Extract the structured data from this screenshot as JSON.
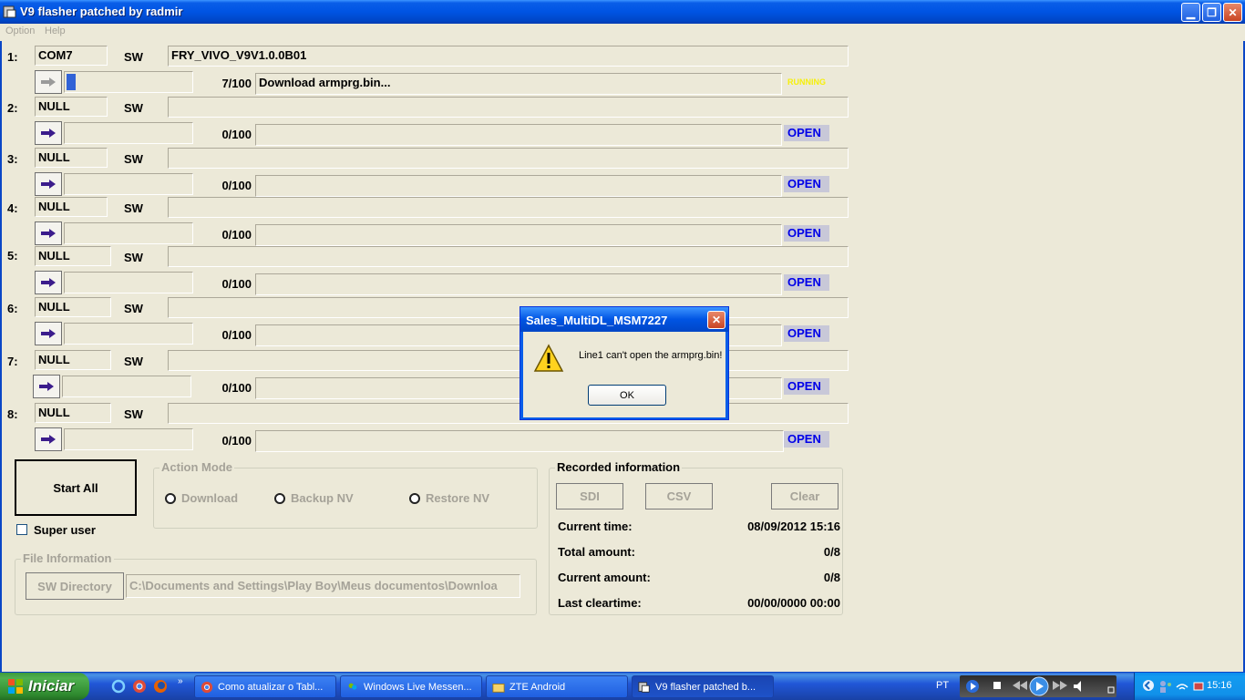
{
  "window": {
    "title": "V9 flasher patched by radmir"
  },
  "menu": {
    "option": "Option",
    "help": "Help"
  },
  "sw_label": "SW",
  "rows": [
    {
      "num": "1:",
      "port": "COM7",
      "sw": "FRY_VIVO_V9V1.0.0B01",
      "count": "7/100",
      "message": "Download armprg.bin...",
      "status": "RUNNING",
      "progress": 0.07
    },
    {
      "num": "2:",
      "port": "NULL",
      "sw": "",
      "count": "0/100",
      "message": "",
      "status": "OPEN",
      "progress": 0
    },
    {
      "num": "3:",
      "port": "NULL",
      "sw": "",
      "count": "0/100",
      "message": "",
      "status": "OPEN",
      "progress": 0
    },
    {
      "num": "4:",
      "port": "NULL",
      "sw": "",
      "count": "0/100",
      "message": "",
      "status": "OPEN",
      "progress": 0
    },
    {
      "num": "5:",
      "port": "NULL",
      "sw": "",
      "count": "0/100",
      "message": "",
      "status": "OPEN",
      "progress": 0
    },
    {
      "num": "6:",
      "port": "NULL",
      "sw": "",
      "count": "0/100",
      "message": "",
      "status": "OPEN",
      "progress": 0
    },
    {
      "num": "7:",
      "port": "NULL",
      "sw": "",
      "count": "0/100",
      "message": "",
      "status": "OPEN",
      "progress": 0
    },
    {
      "num": "8:",
      "port": "NULL",
      "sw": "",
      "count": "0/100",
      "message": "",
      "status": "OPEN",
      "progress": 0
    }
  ],
  "controls": {
    "start_all": "Start All",
    "super_user": "Super user",
    "action_mode": {
      "title": "Action Mode",
      "download": "Download",
      "backup": "Backup NV",
      "restore": "Restore NV"
    },
    "file_info": {
      "title": "File Information",
      "sw_dir_button": "SW Directory",
      "path": "C:\\Documents and Settings\\Play  Boy\\Meus documentos\\Downloa"
    }
  },
  "recorded": {
    "title": "Recorded information",
    "sdi": "SDI",
    "csv": "CSV",
    "clear": "Clear",
    "current_time_label": "Current time:",
    "current_time": "08/09/2012 15:16",
    "total_label": "Total amount:",
    "total": "0/8",
    "current_label": "Current amount:",
    "current": "0/8",
    "last_clear_label": "Last cleartime:",
    "last_clear": "00/00/0000 00:00"
  },
  "dialog": {
    "title": "Sales_MultiDL_MSM7227",
    "message": "Line1 can't open the armprg.bin!",
    "ok": "OK"
  },
  "taskbar": {
    "start": "Iniciar",
    "items": [
      "Como atualizar o Tabl...",
      "Windows Live Messen...",
      "ZTE Android",
      "V9 flasher patched b..."
    ],
    "lang": "PT",
    "clock": "15:16"
  },
  "colors": {
    "titlebar": "#0054e3",
    "status_open": "#0000e8",
    "status_running": "#f6f00a",
    "progress": "#3162d6"
  }
}
